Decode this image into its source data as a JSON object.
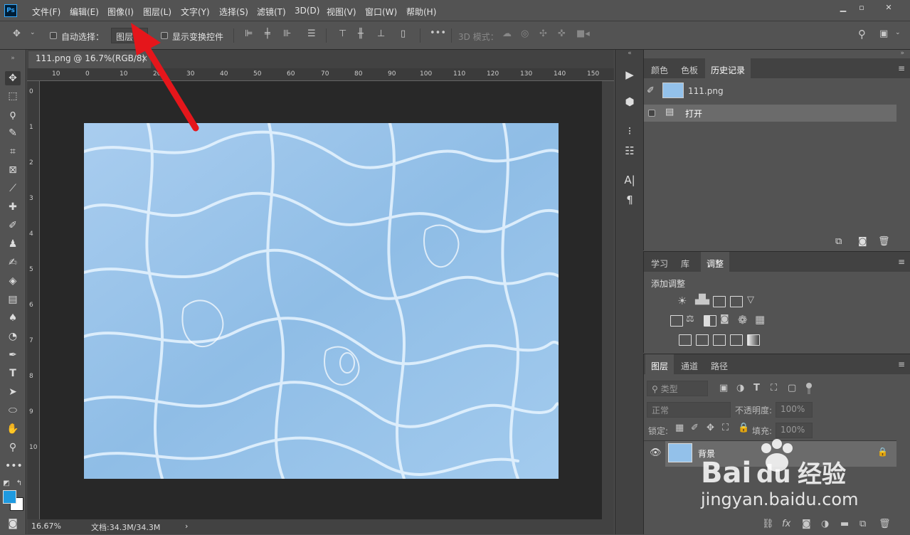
{
  "app": {
    "logo": "Ps"
  },
  "menu": [
    "文件(F)",
    "编辑(E)",
    "图像(I)",
    "图层(L)",
    "文字(Y)",
    "选择(S)",
    "滤镜(T)",
    "3D(D)",
    "视图(V)",
    "窗口(W)",
    "帮助(H)"
  ],
  "window_controls": [
    "minimize",
    "restore",
    "close"
  ],
  "options": {
    "auto_select_label": "自动选择：",
    "auto_select_value": "图层",
    "show_transform_label": "显示变换控件",
    "mode_3d_label": "3D 模式："
  },
  "document": {
    "tab_title": "111.png @ 16.7%(RGB/8)",
    "close_glyph": "×",
    "ruler_h": [
      "10",
      "0",
      "10",
      "20",
      "30",
      "40",
      "50",
      "60",
      "70",
      "80",
      "90",
      "100",
      "110",
      "120",
      "130",
      "140",
      "150"
    ],
    "ruler_v": [
      "0",
      "1",
      "2",
      "3",
      "4",
      "5",
      "6",
      "7",
      "8",
      "9",
      "10"
    ]
  },
  "status": {
    "zoom": "16.67%",
    "doc_size": "文档:34.3M/34.3M",
    "arrow": "›"
  },
  "history_panel": {
    "tabs": [
      "颜色",
      "色板",
      "历史记录"
    ],
    "active_tab": "历史记录",
    "snapshot": "111.png",
    "steps": [
      "打开"
    ]
  },
  "adjust_panel": {
    "tabs": [
      "学习",
      "库",
      "调整"
    ],
    "active_tab": "调整",
    "title": "添加调整"
  },
  "layers_panel": {
    "tabs": [
      "图层",
      "通道",
      "路径"
    ],
    "active_tab": "图层",
    "filter_kind": "类型",
    "blend_mode": "正常",
    "opacity_label": "不透明度:",
    "opacity_value": "100%",
    "lock_label": "锁定:",
    "fill_label": "填充:",
    "fill_value": "100%",
    "layers": [
      {
        "name": "背景",
        "visible": true,
        "locked": true
      }
    ]
  },
  "watermark": {
    "brand": "Bai du 经验",
    "url": "jingyan.baidu.com"
  },
  "colors": {
    "foreground": "#1e9ae0",
    "background": "#ffffff",
    "arrow": "#e5161b"
  }
}
